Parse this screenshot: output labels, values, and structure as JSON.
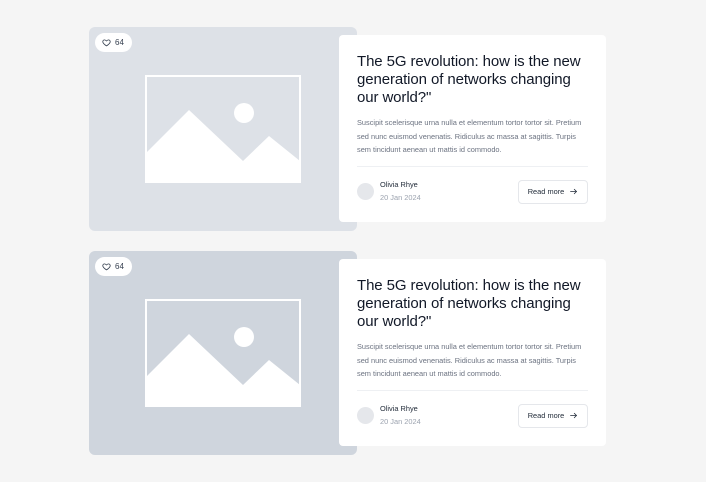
{
  "colors": {
    "background": "#f5f5f5",
    "image_panel_1": "#dde1e7",
    "image_panel_2": "#cfd5dd",
    "card": "#ffffff",
    "text_primary": "#111827",
    "text_muted": "#6b7280"
  },
  "posts": [
    {
      "likes": "64",
      "like_icon": "heart-icon",
      "image_icon": "image-placeholder-icon",
      "title": "The 5G revolution: how is the new generation of networks changing our world?\"",
      "excerpt": "Suscipit scelerisque urna nulla et elementum tortor tortor sit. Pretium sed nunc euismod venenatis. Ridiculus ac massa at sagittis. Turpis sem tincidunt aenean ut mattis id commodo.",
      "author": "Olivia Rhye",
      "date": "20 Jan 2024",
      "read_more": "Read more",
      "read_more_icon": "arrow-right-icon"
    },
    {
      "likes": "64",
      "like_icon": "heart-icon",
      "image_icon": "image-placeholder-icon",
      "title": "The 5G revolution: how is the new generation of networks changing our world?\"",
      "excerpt": "Suscipit scelerisque urna nulla et elementum tortor tortor sit. Pretium sed nunc euismod venenatis. Ridiculus ac massa at sagittis. Turpis sem tincidunt aenean ut mattis id commodo.",
      "author": "Olivia Rhye",
      "date": "20 Jan 2024",
      "read_more": "Read more",
      "read_more_icon": "arrow-right-icon"
    }
  ]
}
